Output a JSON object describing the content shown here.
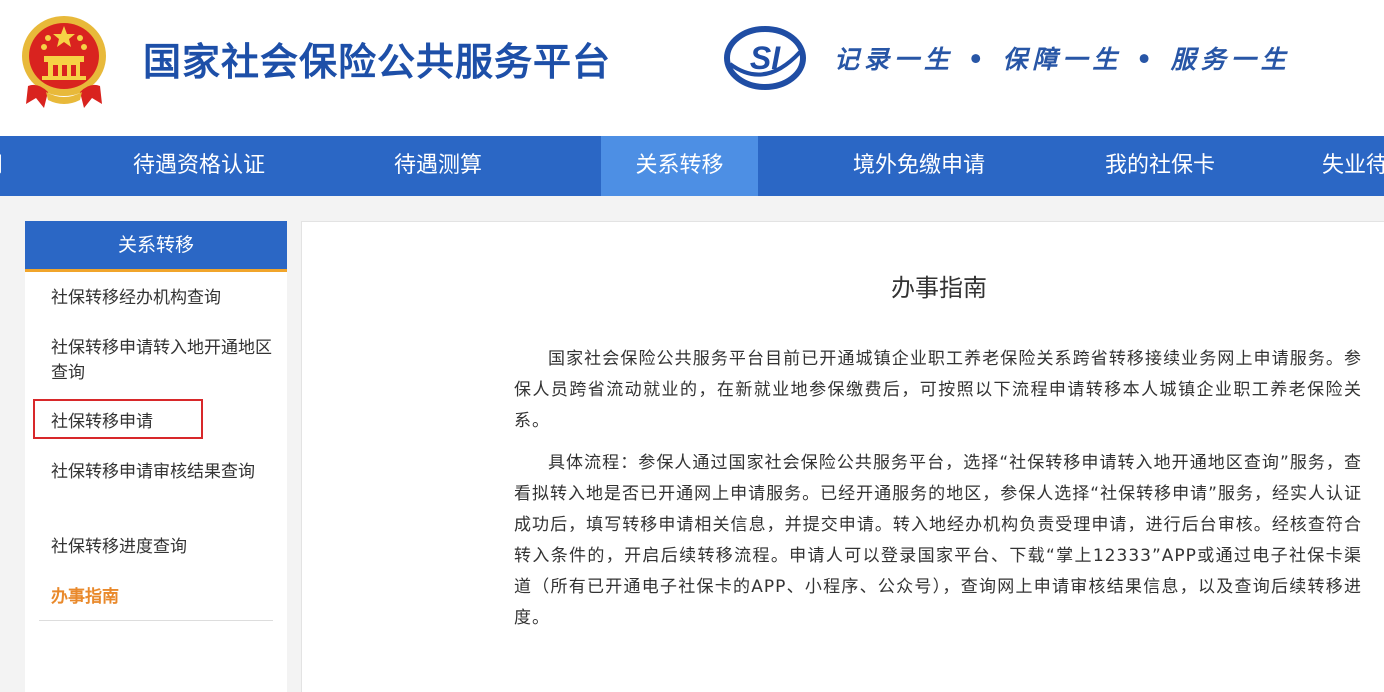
{
  "header": {
    "site_title": "国家社会保险公共服务平台",
    "logo_text": "SI",
    "slogan": "记录一生 • 保障一生 • 服务一生"
  },
  "nav": {
    "items": [
      {
        "label": "问",
        "active": false
      },
      {
        "label": "待遇资格认证",
        "active": false
      },
      {
        "label": "待遇测算",
        "active": false
      },
      {
        "label": "关系转移",
        "active": true
      },
      {
        "label": "境外免缴申请",
        "active": false
      },
      {
        "label": "我的社保卡",
        "active": false
      },
      {
        "label": "失业待",
        "active": false
      }
    ]
  },
  "sidebar": {
    "title": "关系转移",
    "items": [
      {
        "label": "社保转移经办机构查询"
      },
      {
        "label": "社保转移申请转入地开通地区查询"
      },
      {
        "label": "社保转移申请"
      },
      {
        "label": "社保转移申请审核结果查询"
      },
      {
        "label": "社保转移进度查询"
      },
      {
        "label": "办事指南"
      }
    ]
  },
  "main": {
    "title": "办事指南",
    "paragraphs": [
      "国家社会保险公共服务平台目前已开通城镇企业职工养老保险关系跨省转移接续业务网上申请服务。参保人员跨省流动就业的，在新就业地参保缴费后，可按照以下流程申请转移本人城镇企业职工养老保险关系。",
      "具体流程：参保人通过国家社会保险公共服务平台，选择“社保转移申请转入地开通地区查询”服务，查看拟转入地是否已开通网上申请服务。已经开通服务的地区，参保人选择“社保转移申请”服务，经实人认证成功后，填写转移申请相关信息，并提交申请。转入地经办机构负责受理申请，进行后台审核。经核查符合转入条件的，开启后续转移流程。申请人可以登录国家平台、下载“掌上12333”APP或通过电子社保卡渠道（所有已开通电子社保卡的APP、小程序、公众号），查询网上申请审核结果信息，以及查询后续转移进度。"
    ]
  },
  "colors": {
    "nav_blue": "#2b67c5",
    "nav_active": "#4d8fe4",
    "title_blue": "#1d4fa8",
    "accent_orange": "#e9892b",
    "highlight_red": "#d8282a"
  }
}
